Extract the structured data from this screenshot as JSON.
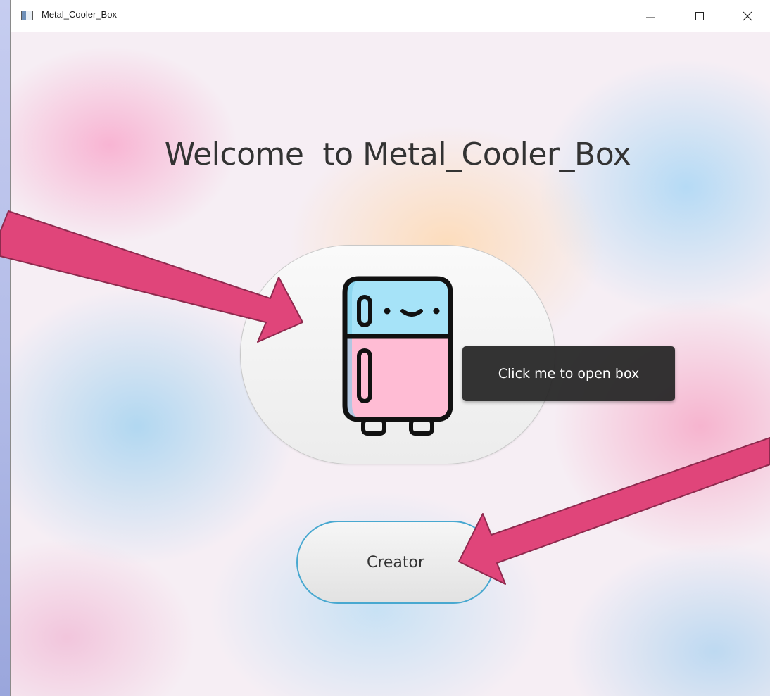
{
  "window": {
    "title": "Metal_Cooler_Box"
  },
  "controls": {
    "minimize_icon": "minimize-icon",
    "maximize_icon": "maximize-icon",
    "close_icon": "close-icon"
  },
  "main": {
    "welcome_title": "Welcome  to Metal_Cooler_Box",
    "open_box_tooltip": "Click me to open box",
    "creator_label": "Creator",
    "fridge_icon": "fridge-icon"
  },
  "annotations": {
    "arrow_color": "#e0457a"
  },
  "colors": {
    "fridge_top": "#a6e3f8",
    "fridge_bottom": "#ffbcd4",
    "creator_border": "#48a8d0",
    "tooltip_bg": "#282828"
  }
}
